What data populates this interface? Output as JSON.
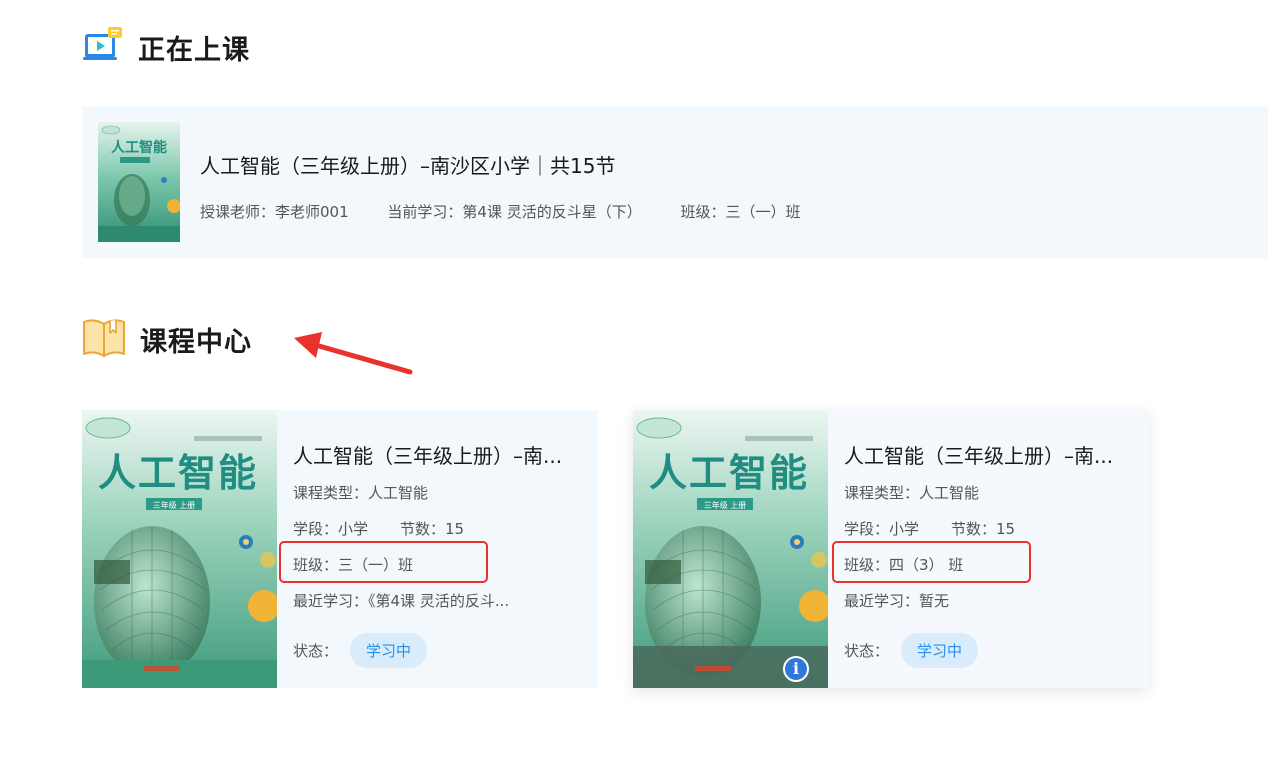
{
  "now_section": {
    "title": "正在上课",
    "course": {
      "title": "人工智能（三年级上册）–南沙区小学｜共15节",
      "cover_text": "人工智能",
      "teacher": "授课老师：李老师001",
      "current": "当前学习：第4课 灵活的反斗星（下）",
      "class": "班级：三（一）班"
    }
  },
  "center_section": {
    "title": "课程中心",
    "courses": [
      {
        "cover_text": "人工智能",
        "cover_sub": "三年级 上册",
        "title": "人工智能（三年级上册）–南...",
        "type": "课程类型：人工智能",
        "stage": "学段：小学",
        "lessons": "节数：15",
        "class": "班级：三（一）班",
        "recent": "最近学习：《第4课 灵活的反斗...",
        "status_label": "状态：",
        "status": "学习中"
      },
      {
        "cover_text": "人工智能",
        "cover_sub": "三年级 上册",
        "title": "人工智能（三年级上册）–南...",
        "type": "课程类型：人工智能",
        "stage": "学段：小学",
        "lessons": "节数：15",
        "class": "班级：四（3） 班",
        "recent": "最近学习：暂无",
        "status_label": "状态：",
        "status": "学习中",
        "info_icon": "i"
      }
    ]
  },
  "colors": {
    "card_bg": "#f3f8fc",
    "badge_bg": "#d8ecfb",
    "badge_text": "#2a8fe6",
    "highlight": "#e8322b"
  }
}
